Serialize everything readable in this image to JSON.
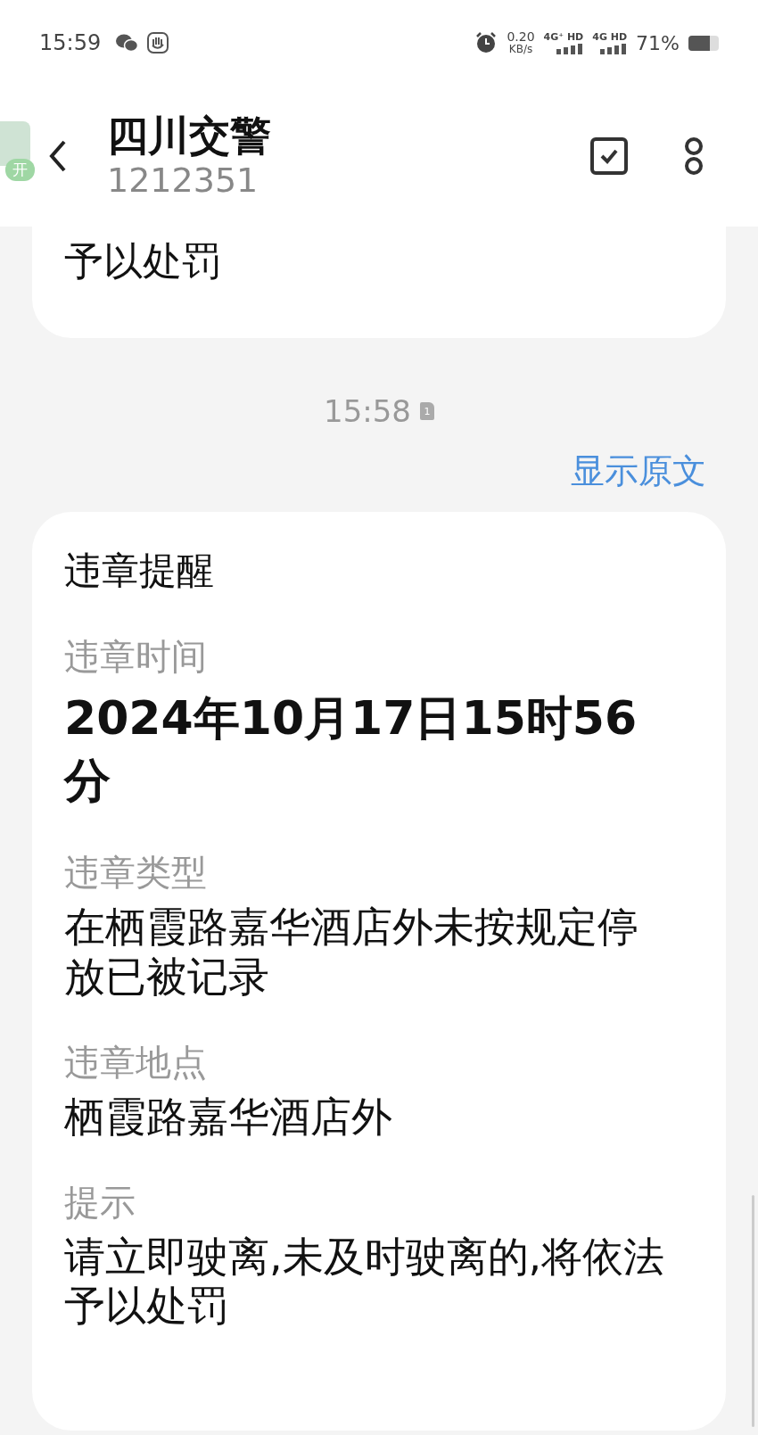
{
  "status_bar": {
    "time": "15:59",
    "net_speed": "0.20",
    "net_unit": "KB/s",
    "sim1": "4G⁺ HD",
    "sim2": "4G HD",
    "battery": "71%"
  },
  "header": {
    "title": "四川交警",
    "number": "1212351"
  },
  "floating_widget": {
    "badge": "开"
  },
  "previous_message": {
    "text": "予以处罚"
  },
  "timestamp": {
    "time": "15:58",
    "sim": "1"
  },
  "show_original": "显示原文",
  "card": {
    "title": "违章提醒",
    "fields": [
      {
        "label": "违章时间",
        "value": "2024年10月17日15时56分",
        "emphasis": true
      },
      {
        "label": "违章类型",
        "value": "在栖霞路嘉华酒店外未按规定停放已被记录",
        "emphasis": false
      },
      {
        "label": "违章地点",
        "value": "栖霞路嘉华酒店外",
        "emphasis": false
      },
      {
        "label": "提示",
        "value": "请立即驶离,未及时驶离的,将依法予以处罚",
        "emphasis": false
      }
    ]
  }
}
